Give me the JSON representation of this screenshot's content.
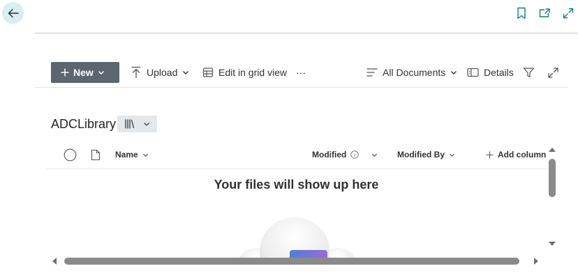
{
  "colors": {
    "accent": "#0f7b8a",
    "new_button_bg": "#5b6670",
    "view_button_bg": "#e4e8eb",
    "back_button_bg": "#d7eef2",
    "scroll_thumb": "#8a8a8a"
  },
  "topbar": {
    "back_icon": "arrow-left-icon",
    "icons": [
      "bookmark-icon",
      "share-out-icon",
      "expand-icon"
    ]
  },
  "commandbar": {
    "new_label": "New",
    "upload_label": "Upload",
    "grid_label": "Edit in grid view",
    "more_label": "···",
    "view_label": "All Documents",
    "details_label": "Details"
  },
  "library": {
    "title": "ADCLibrary"
  },
  "columns": {
    "name": "Name",
    "modified": "Modified",
    "modified_by": "Modified By",
    "add_column": "Add column"
  },
  "empty_state": {
    "message": "Your files will show up here"
  }
}
